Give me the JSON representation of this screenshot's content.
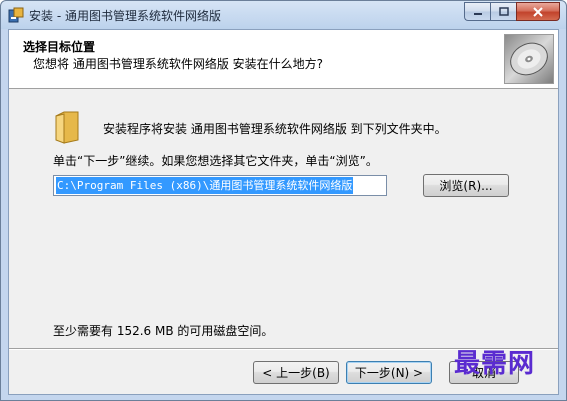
{
  "window": {
    "title": "安装 - 通用图书管理系统软件网络版"
  },
  "header": {
    "title": "选择目标位置",
    "subtitle": "您想将 通用图书管理系统软件网络版 安装在什么地方?",
    "icon": "disc-icon"
  },
  "body": {
    "intro": "安装程序将安装 通用图书管理系统软件网络版 到下列文件夹中。",
    "instruction": "单击“下一步”继续。如果您想选择其它文件夹，单击“浏览”。",
    "install_path": "C:\\Program Files (x86)\\通用图书管理系统软件网络版",
    "browse_label": "浏览(R)...",
    "disk_space": "至少需要有 152.6 MB 的可用磁盘空间。"
  },
  "footer": {
    "back_label": "< 上一步(B)",
    "next_label": "下一步(N) >",
    "cancel_label": "取消"
  },
  "watermark": "最需网",
  "colors": {
    "selection": "#3399ff",
    "close_button": "#c2432c",
    "watermark": "#5a2bd0"
  }
}
